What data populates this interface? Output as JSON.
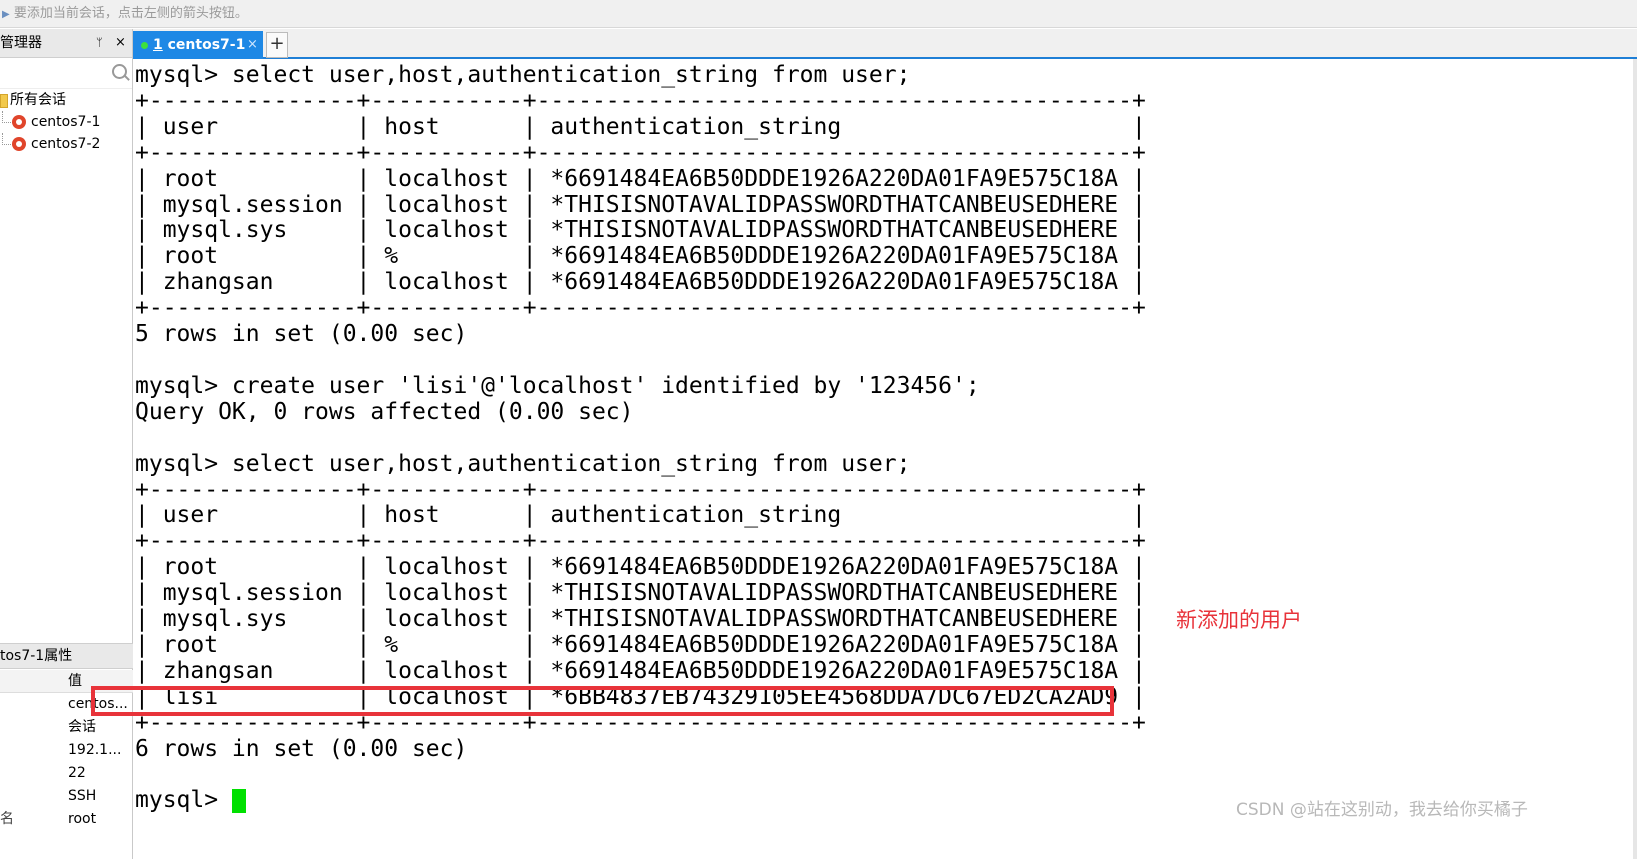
{
  "hint": {
    "text": "要添加当前会话，点击左侧的箭头按钮。"
  },
  "session_manager": {
    "title": "管理器",
    "pin": "ᛘ",
    "close": "×",
    "tree": {
      "root_label": "所有会话",
      "sessions": [
        {
          "label": "centos7-1"
        },
        {
          "label": "centos7-2"
        }
      ]
    }
  },
  "properties": {
    "title": "tos7-1属性",
    "value_header": "值",
    "rows": [
      {
        "key": "",
        "value": "centos..."
      },
      {
        "key": "",
        "value": "会话"
      },
      {
        "key": "",
        "value": "192.1..."
      },
      {
        "key": "",
        "value": "22"
      },
      {
        "key": "",
        "value": "SSH"
      },
      {
        "key": "名",
        "value": "root"
      }
    ]
  },
  "tabs": [
    {
      "number": "1",
      "label": "centos7-1",
      "close": "×",
      "status_color": "#3de13d"
    }
  ],
  "new_tab": "+",
  "terminal": {
    "output": "mysql> select user,host,authentication_string from user;\n+---------------+-----------+-------------------------------------------+\n| user          | host      | authentication_string                     |\n+---------------+-----------+-------------------------------------------+\n| root          | localhost | *6691484EA6B50DDDE1926A220DA01FA9E575C18A |\n| mysql.session | localhost | *THISISNOTAVALIDPASSWORDTHATCANBEUSEDHERE |\n| mysql.sys     | localhost | *THISISNOTAVALIDPASSWORDTHATCANBEUSEDHERE |\n| root          | %         | *6691484EA6B50DDDE1926A220DA01FA9E575C18A |\n| zhangsan      | localhost | *6691484EA6B50DDDE1926A220DA01FA9E575C18A |\n+---------------+-----------+-------------------------------------------+\n5 rows in set (0.00 sec)\n\nmysql> create user 'lisi'@'localhost' identified by '123456';\nQuery OK, 0 rows affected (0.00 sec)\n\nmysql> select user,host,authentication_string from user;\n+---------------+-----------+-------------------------------------------+\n| user          | host      | authentication_string                     |\n+---------------+-----------+-------------------------------------------+\n| root          | localhost | *6691484EA6B50DDDE1926A220DA01FA9E575C18A |\n| mysql.session | localhost | *THISISNOTAVALIDPASSWORDTHATCANBEUSEDHERE |\n| mysql.sys     | localhost | *THISISNOTAVALIDPASSWORDTHATCANBEUSEDHERE |\n| root          | %         | *6691484EA6B50DDDE1926A220DA01FA9E575C18A |\n| zhangsan      | localhost | *6691484EA6B50DDDE1926A220DA01FA9E575C18A |\n| lisi          | localhost | *6BB4837EB74329105EE4568DDA7DC67ED2CA2AD9 |\n+---------------+-----------+-------------------------------------------+\n6 rows in set (0.00 sec)\n\n",
    "prompt": "mysql> ",
    "cursor_color": "#00e000"
  },
  "annotation": {
    "text": "新添加的用户",
    "color": "#e8333a"
  },
  "watermark": {
    "text": "CSDN @站在这别动，我去给你买橘子"
  }
}
